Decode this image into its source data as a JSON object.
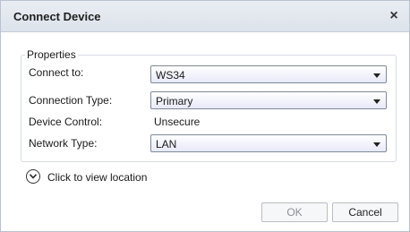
{
  "dialog": {
    "title": "Connect Device",
    "close_glyph": "×"
  },
  "properties": {
    "group_title": "Properties",
    "fields": [
      {
        "label": "Connect to:",
        "value": "WS34",
        "kind": "dropdown"
      },
      {
        "label": "Connection Type:",
        "value": "Primary",
        "kind": "dropdown"
      },
      {
        "label": "Device Control:",
        "value": "Unsecure",
        "kind": "static"
      },
      {
        "label": "Network Type:",
        "value": "LAN",
        "kind": "dropdown"
      }
    ]
  },
  "expander": {
    "label": "Click to view location",
    "icon": "chevron-down-circle-icon"
  },
  "buttons": {
    "ok_label": "OK",
    "ok_enabled": false,
    "cancel_label": "Cancel"
  }
}
